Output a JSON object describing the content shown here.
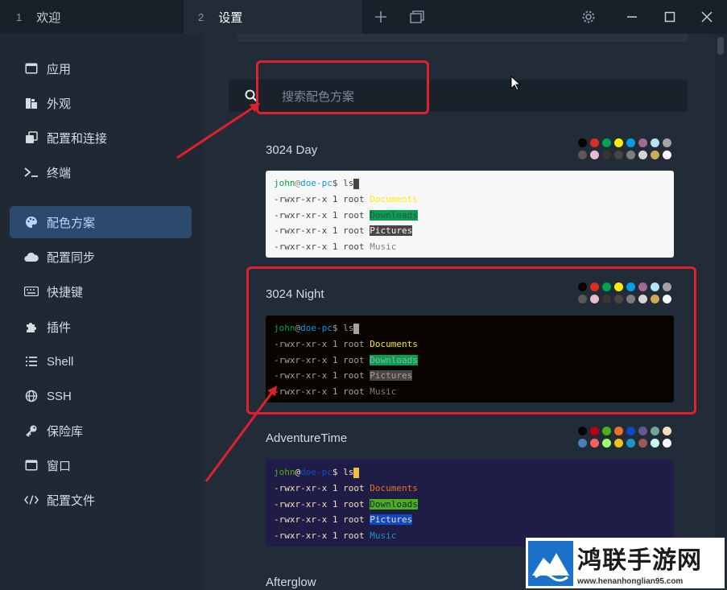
{
  "tabs": [
    {
      "num": "1",
      "label": "欢迎"
    },
    {
      "num": "2",
      "label": "设置"
    }
  ],
  "window_icons": [
    "plus-icon",
    "copy-window-icon",
    "gear-icon",
    "minimize-icon",
    "maximize-icon",
    "close-icon"
  ],
  "sidebar": {
    "items": [
      {
        "label": "应用",
        "icon": "app-window-icon"
      },
      {
        "label": "外观",
        "icon": "appearance-icon"
      },
      {
        "label": "配置和连接",
        "icon": "profiles-icon"
      },
      {
        "label": "终端",
        "icon": "terminal-icon"
      },
      {
        "label": "配色方案",
        "icon": "palette-icon",
        "active": true
      },
      {
        "label": "配置同步",
        "icon": "cloud-icon"
      },
      {
        "label": "快捷键",
        "icon": "keyboard-icon"
      },
      {
        "label": "插件",
        "icon": "puzzle-icon"
      },
      {
        "label": "Shell",
        "icon": "list-icon"
      },
      {
        "label": "SSH",
        "icon": "globe-icon"
      },
      {
        "label": "保险库",
        "icon": "key-icon"
      },
      {
        "label": "窗口",
        "icon": "window-icon"
      },
      {
        "label": "配置文件",
        "icon": "code-icon"
      }
    ]
  },
  "search": {
    "placeholder": "搜索配色方案"
  },
  "terminal_lines": {
    "user": "john",
    "at": "@",
    "host": "doe-pc",
    "prompt": "$ ",
    "command": "ls",
    "perm": "-rwxr-xr-x 1 root ",
    "dirs": [
      "Documents",
      "Downloads",
      "Pictures",
      "Music"
    ]
  },
  "schemes": [
    {
      "name": "3024 Day",
      "bg": "#f7f7f7",
      "fg": "#4a4543",
      "user": "#01a252",
      "at": "#807d7c",
      "host": "#01a0e4",
      "dollar": "#4a4543",
      "cursor": "#4a4543",
      "dirs_fg": [
        "#fded02",
        "#4a4543",
        "#f7f7f7",
        "#807d7c"
      ],
      "dirs_bg": [
        "transparent",
        "#01a252",
        "#4a4543",
        "transparent"
      ],
      "palette": [
        "#090300",
        "#db2d20",
        "#01a252",
        "#fded02",
        "#01a0e4",
        "#a16a94",
        "#b5e4f4",
        "#a5a2a2",
        "#5c5855",
        "#e8bbd0",
        "#3a3432",
        "#4a4543",
        "#807d7c",
        "#d6d5d4",
        "#cdab53",
        "#f7f7f7"
      ]
    },
    {
      "name": "3024 Night",
      "bg": "#090300",
      "fg": "#a5a2a2",
      "user": "#01a252",
      "at": "#a5a2a2",
      "host": "#01a0e4",
      "dollar": "#a5a2a2",
      "cursor": "#a5a2a2",
      "dirs_fg": [
        "#fded02",
        "#a5a2a2",
        "#a5a2a2",
        "#807d7c"
      ],
      "dirs_bg": [
        "transparent",
        "#01a252",
        "#4a4543",
        "transparent"
      ],
      "palette": [
        "#090300",
        "#db2d20",
        "#01a252",
        "#fded02",
        "#01a0e4",
        "#a16a94",
        "#b5e4f4",
        "#a5a2a2",
        "#5c5855",
        "#e8bbd0",
        "#3a3432",
        "#4a4543",
        "#807d7c",
        "#d6d5d4",
        "#cdab53",
        "#f7f7f7"
      ]
    },
    {
      "name": "AdventureTime",
      "bg": "#1f1d45",
      "fg": "#f8dcc0",
      "user": "#4ab118",
      "at": "#f8dcc0",
      "host": "#0f4ac6",
      "dollar": "#f8dcc0",
      "cursor": "#efbf38",
      "dirs_fg": [
        "#e7741e",
        "#1f1d45",
        "#f8dcc0",
        "#1997c6"
      ],
      "dirs_bg": [
        "transparent",
        "#4ab118",
        "#0f4ac6",
        "transparent"
      ],
      "palette": [
        "#050404",
        "#bd0013",
        "#4ab118",
        "#e7741e",
        "#0f4ac6",
        "#665993",
        "#70a598",
        "#f8dcc0",
        "#4e7cbf",
        "#fc5f5a",
        "#9eff6e",
        "#efc11a",
        "#1997c6",
        "#9b5953",
        "#c8faf4",
        "#f6f5fb"
      ]
    },
    {
      "name": "Afterglow"
    }
  ],
  "watermark": {
    "brand": "鸿联手游网",
    "url": "www.henanhonglian95.com"
  }
}
